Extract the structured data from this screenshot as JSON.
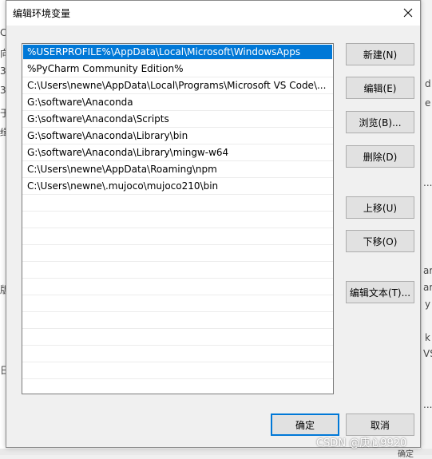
{
  "dialog": {
    "title": "编辑环境变量"
  },
  "path_entries": [
    "%USERPROFILE%\\AppData\\Local\\Microsoft\\WindowsApps",
    "%PyCharm Community Edition%",
    "C:\\Users\\newne\\AppData\\Local\\Programs\\Microsoft VS Code\\...",
    "G:\\software\\Anaconda",
    "G:\\software\\Anaconda\\Scripts",
    "G:\\software\\Anaconda\\Library\\bin",
    "G:\\software\\Anaconda\\Library\\mingw-w64",
    "C:\\Users\\newne\\AppData\\Roaming\\npm",
    "C:\\Users\\newne\\.mujoco\\mujoco210\\bin"
  ],
  "selected_index": 0,
  "buttons": {
    "new": "新建(N)",
    "edit": "编辑(E)",
    "browse": "浏览(B)...",
    "delete": "删除(D)",
    "move_up": "上移(U)",
    "move_down": "下移(O)",
    "edit_text": "编辑文本(T)...",
    "ok": "确定",
    "cancel": "取消"
  },
  "watermark": "CSDN @庚心9920",
  "background_fragments": {
    "left": [
      "C",
      "向",
      "3",
      "3",
      "于",
      "缉",
      "版",
      "日"
    ],
    "right": [
      "d",
      "e",
      "...",
      "ar",
      "ar",
      "y",
      "k",
      "VS",
      "..."
    ],
    "bottom": "确定"
  },
  "colors": {
    "selection": "#0078d7",
    "dialog_bg": "#f0f0f0",
    "button_bg": "#e1e1e1"
  }
}
